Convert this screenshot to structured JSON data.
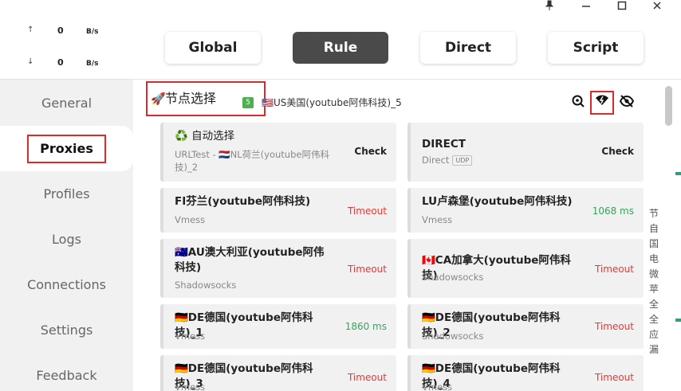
{
  "window": {
    "controls": [
      "pin-icon",
      "minimize-icon",
      "maximize-icon",
      "close-icon"
    ]
  },
  "traffic": {
    "up": {
      "arrow": "↑",
      "value": "0",
      "unit": "B/s"
    },
    "down": {
      "arrow": "↓",
      "value": "0",
      "unit": "B/s"
    }
  },
  "sidebar": {
    "items": [
      {
        "label": "General"
      },
      {
        "label": "Proxies"
      },
      {
        "label": "Profiles"
      },
      {
        "label": "Logs"
      },
      {
        "label": "Connections"
      },
      {
        "label": "Settings"
      },
      {
        "label": "Feedback"
      }
    ],
    "active": "Proxies"
  },
  "modes": [
    {
      "label": "Global"
    },
    {
      "label": "Rule"
    },
    {
      "label": "Direct"
    },
    {
      "label": "Script"
    }
  ],
  "active_mode": "Rule",
  "group": {
    "icon": "🚀",
    "title": "节点选择",
    "count": "5",
    "selected": "🇺🇸US美国(youtube阿伟科技)_5",
    "icons": [
      "search-location-icon",
      "wifi-test-icon",
      "eye-off-icon"
    ]
  },
  "proxies": [
    {
      "name": "♻️ 自动选择",
      "type": "URLTest - 🇳🇱NL荷兰(youtube阿伟科技)_2",
      "delay": "Check",
      "status": "check"
    },
    {
      "name": "DIRECT",
      "type": "Direct",
      "udp": "UDP",
      "delay": "Check",
      "status": "check"
    },
    {
      "name": "FI芬兰(youtube阿伟科技)",
      "type": "Vmess",
      "delay": "Timeout",
      "status": "timeout"
    },
    {
      "name": "LU卢森堡(youtube阿伟科技)",
      "type": "Vmess",
      "delay": "1068 ms",
      "status": "ok"
    },
    {
      "name": "🇦🇺AU澳大利亚(youtube阿伟科技)",
      "type": "Shadowsocks",
      "delay": "Timeout",
      "status": "timeout"
    },
    {
      "name": "🇨🇦CA加拿大(youtube阿伟科技)",
      "type": "Shadowsocks",
      "delay": "Timeout",
      "status": "timeout"
    },
    {
      "name": "🇩🇪DE德国(youtube阿伟科技)_1",
      "type": "Vmess",
      "delay": "1860 ms",
      "status": "ok"
    },
    {
      "name": "🇩🇪DE德国(youtube阿伟科技)_2",
      "type": "Shadowsocks",
      "delay": "Timeout",
      "status": "timeout"
    },
    {
      "name": "🇩🇪DE德国(youtube阿伟科技)_3",
      "type": "Vmess",
      "delay": "Timeout",
      "status": "timeout"
    },
    {
      "name": "🇩🇪DE德国(youtube阿伟科技)_4",
      "type": "Vmess",
      "delay": "Timeout",
      "status": "timeout"
    }
  ],
  "edge_text": [
    "节",
    "自",
    "国",
    "电",
    "微",
    "苹",
    "全",
    "全",
    "应",
    "漏"
  ],
  "colors": {
    "accent": "#4a4a4a",
    "highlight_box": "#d92b2b",
    "timeout": "#e53935",
    "ok": "#3aa35a"
  }
}
